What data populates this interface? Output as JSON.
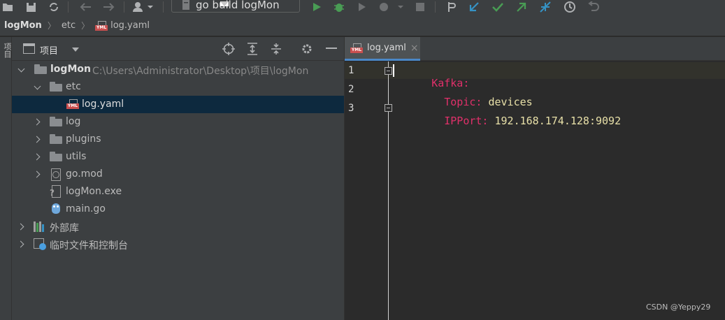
{
  "toolbar": {
    "run_config_label": "go build logMon",
    "icons": [
      "open-folder-icon",
      "save-icon",
      "sync-icon",
      "back-icon",
      "forward-icon",
      "user-icon",
      "run-icon",
      "debug-icon",
      "coverage-icon",
      "profile-icon",
      "stop-icon",
      "vcs-icon",
      "update-icon",
      "commit-icon",
      "push-icon",
      "merge-icon",
      "history-icon",
      "revert-icon"
    ]
  },
  "breadcrumb": {
    "root": "logMon",
    "items": [
      "etc",
      "log.yaml"
    ]
  },
  "left_strip": {
    "tab_label": "项目"
  },
  "project_panel": {
    "title": "项目",
    "tree": {
      "root_name": "logMon",
      "root_path": "C:\\Users\\Administrator\\Desktop\\项目\\logMon",
      "etc": "etc",
      "log_yaml": "log.yaml",
      "log": "log",
      "plugins": "plugins",
      "utils": "utils",
      "go_mod": "go.mod",
      "logmon_exe": "logMon.exe",
      "main_go": "main.go",
      "external_libs": "外部库",
      "scratches": "临时文件和控制台"
    }
  },
  "editor": {
    "tab_label": "log.yaml",
    "tab_close": "×",
    "lines": [
      {
        "num": "1",
        "key": "Kafka:",
        "value": ""
      },
      {
        "num": "2",
        "key": "  Topic:",
        "value": " devices"
      },
      {
        "num": "3",
        "key": "  IPPort:",
        "value": " 192.168.174.128:9092"
      }
    ],
    "colors": {
      "key": "#e0306a",
      "value": "#e8e0a8",
      "accent": "#4a88c7"
    }
  },
  "watermark": "CSDN @Yeppy29"
}
